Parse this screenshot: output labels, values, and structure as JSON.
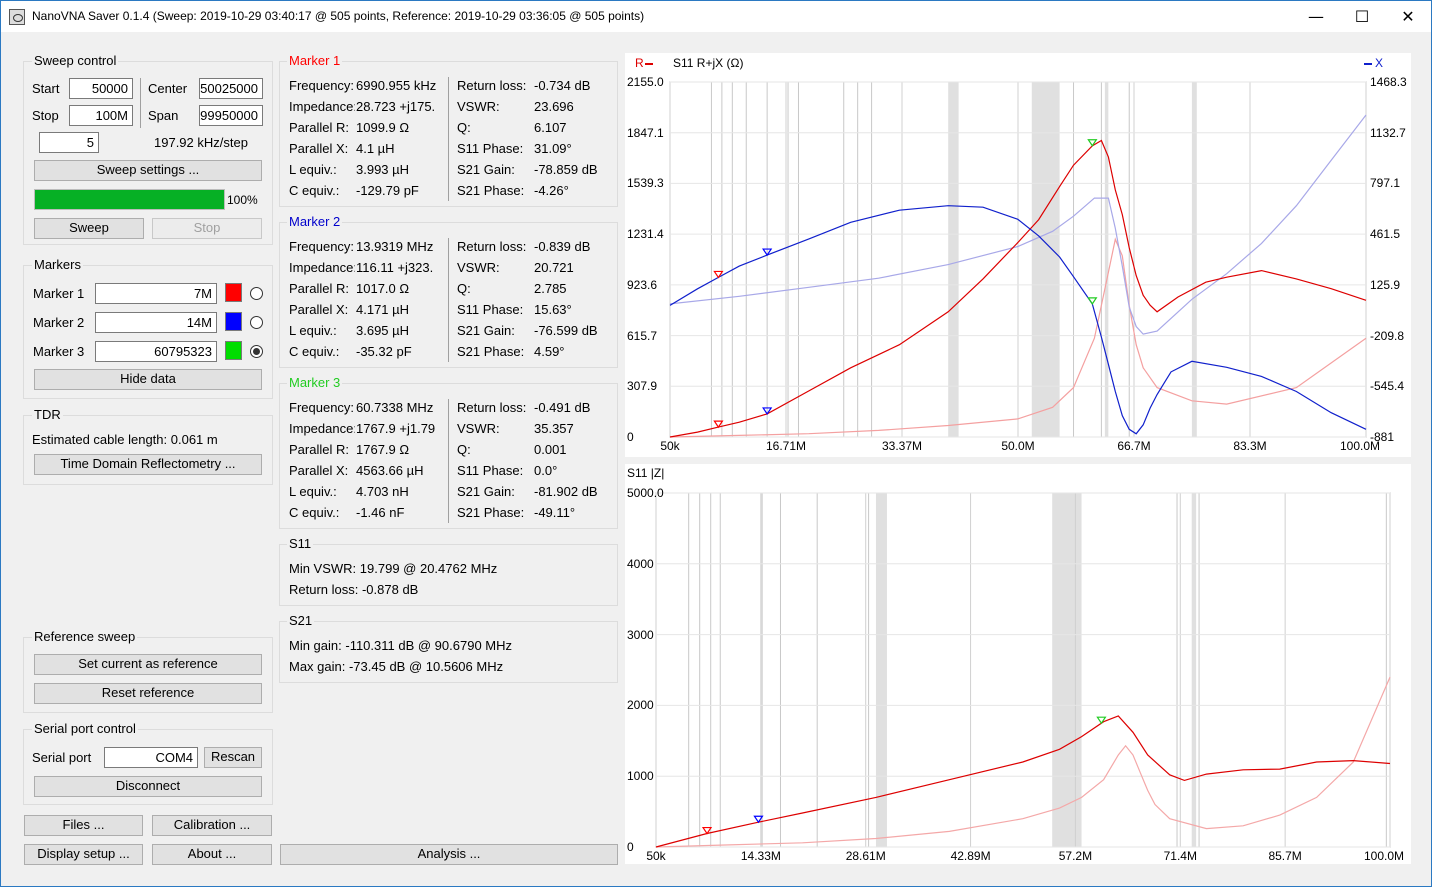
{
  "window": {
    "title": "NanoVNA Saver 0.1.4 (Sweep: 2019-10-29 03:40:17 @ 505 points, Reference: 2019-10-29 03:36:05 @ 505 points)",
    "minimize": "—",
    "maximize": "☐",
    "close": "✕"
  },
  "sweep_control": {
    "title": "Sweep control",
    "start_label": "Start",
    "start_value": "50000",
    "stop_label": "Stop",
    "stop_value": "100M",
    "center_label": "Center",
    "center_value": "50025000",
    "span_label": "Span",
    "span_value": "99950000",
    "points_value": "5",
    "step_text": "197.92 kHz/step",
    "settings_button": "Sweep settings ...",
    "progress_percent": 100,
    "progress_text": "100%",
    "sweep_button": "Sweep",
    "stop_button": "Stop"
  },
  "markers": {
    "title": "Markers",
    "items": [
      {
        "label": "Marker 1",
        "value": "7M",
        "color": "#ff0000",
        "selected": false
      },
      {
        "label": "Marker 2",
        "value": "14M",
        "color": "#0000ff",
        "selected": false
      },
      {
        "label": "Marker 3",
        "value": "60795323",
        "color": "#00dd00",
        "selected": true
      }
    ],
    "hide_button": "Hide data"
  },
  "tdr": {
    "title": "TDR",
    "cable_text": "Estimated cable length: 0.061 m",
    "button": "Time Domain Reflectometry ..."
  },
  "reference_sweep": {
    "title": "Reference sweep",
    "set_button": "Set current as reference",
    "reset_button": "Reset reference"
  },
  "serial": {
    "title": "Serial port control",
    "port_label": "Serial port",
    "port_value": "COM4",
    "rescan_button": "Rescan",
    "disconnect_button": "Disconnect"
  },
  "bottom_buttons": {
    "files": "Files ...",
    "calibration": "Calibration ...",
    "display_setup": "Display setup ...",
    "about": "About ...",
    "analysis": "Analysis ..."
  },
  "marker_panels": [
    {
      "title": "Marker 1",
      "color": "#ff0000",
      "left": [
        {
          "k": "Frequency:",
          "v": "6990.955 kHz"
        },
        {
          "k": "Impedance:",
          "v": "28.723 +j175."
        },
        {
          "k": "Parallel R:",
          "v": "1099.9 Ω"
        },
        {
          "k": "Parallel X:",
          "v": "4.1  µH"
        },
        {
          "k": "L equiv.:",
          "v": "3.993  µH"
        },
        {
          "k": "C equiv.:",
          "v": "-129.79  pF"
        }
      ],
      "right": [
        {
          "k": "Return loss:",
          "v": "-0.734 dB"
        },
        {
          "k": "VSWR:",
          "v": "23.696"
        },
        {
          "k": "Q:",
          "v": "6.107"
        },
        {
          "k": "S11  Phase:",
          "v": "31.09°"
        },
        {
          "k": "S21  Gain:",
          "v": "-78.859 dB"
        },
        {
          "k": "S21  Phase:",
          "v": "-4.26°"
        }
      ]
    },
    {
      "title": "Marker 2",
      "color": "#0000cc",
      "left": [
        {
          "k": "Frequency:",
          "v": "13.9319 MHz"
        },
        {
          "k": "Impedance:",
          "v": "116.11 +j323."
        },
        {
          "k": "Parallel R:",
          "v": "1017.0 Ω"
        },
        {
          "k": "Parallel X:",
          "v": "4.171  µH"
        },
        {
          "k": "L equiv.:",
          "v": "3.695  µH"
        },
        {
          "k": "C equiv.:",
          "v": "-35.32  pF"
        }
      ],
      "right": [
        {
          "k": "Return loss:",
          "v": "-0.839 dB"
        },
        {
          "k": "VSWR:",
          "v": "20.721"
        },
        {
          "k": "Q:",
          "v": "2.785"
        },
        {
          "k": "S11  Phase:",
          "v": "15.63°"
        },
        {
          "k": "S21  Gain:",
          "v": "-76.599 dB"
        },
        {
          "k": "S21  Phase:",
          "v": "4.59°"
        }
      ]
    },
    {
      "title": "Marker 3",
      "color": "#22cc22",
      "left": [
        {
          "k": "Frequency:",
          "v": "60.7338 MHz"
        },
        {
          "k": "Impedance:",
          "v": "1767.9 +j1.79"
        },
        {
          "k": "Parallel R:",
          "v": "1767.9 Ω"
        },
        {
          "k": "Parallel X:",
          "v": "4563.66  µH"
        },
        {
          "k": "L equiv.:",
          "v": "4.703  nH"
        },
        {
          "k": "C equiv.:",
          "v": "-1.46  nF"
        }
      ],
      "right": [
        {
          "k": "Return loss:",
          "v": "-0.491 dB"
        },
        {
          "k": "VSWR:",
          "v": "35.357"
        },
        {
          "k": "Q:",
          "v": "0.001"
        },
        {
          "k": "S11  Phase:",
          "v": "0.0°"
        },
        {
          "k": "S21  Gain:",
          "v": "-81.902 dB"
        },
        {
          "k": "S21  Phase:",
          "v": "-49.11°"
        }
      ]
    }
  ],
  "s11_summary": {
    "title": "S11",
    "min_vswr": "Min VSWR:   19.799 @ 20.4762 MHz",
    "return_loss": "Return loss: -0.878 dB"
  },
  "s21_summary": {
    "title": "S21",
    "min_gain": "Min gain:  -110.311 dB @ 90.6790 MHz",
    "max_gain": "Max gain:  -73.45 dB @ 10.5606 MHz"
  },
  "chart_data": [
    {
      "type": "line",
      "title": "S11  R+jX (Ω)",
      "legend_left": "R",
      "legend_right": "X",
      "x_ticks": [
        "50k",
        "16.71M",
        "33.37M",
        "50.0M",
        "66.7M",
        "83.3M",
        "100.0M"
      ],
      "y_left_ticks": [
        "2155.0",
        "1847.1",
        "1539.3",
        "1231.4",
        "923.6",
        "615.7",
        "307.9",
        "0"
      ],
      "y_right_ticks": [
        "1468.3",
        "1132.7",
        "797.1",
        "461.5",
        "125.9",
        "-209.8",
        "-545.4",
        "-881"
      ],
      "xlim": [
        0.05,
        100.0
      ],
      "ylim_left": [
        0,
        2155.0
      ],
      "ylim_right": [
        -881,
        1468.3
      ],
      "series": [
        {
          "name": "R",
          "axis": "left",
          "color": "#dd0000",
          "x": [
            0.05,
            4,
            7,
            10,
            14,
            20,
            26,
            33,
            40,
            45,
            50,
            53,
            56,
            58,
            60.7,
            62,
            63,
            64,
            65,
            66,
            67,
            68,
            69,
            70,
            73,
            77,
            80,
            85,
            90,
            95,
            100
          ],
          "y": [
            0,
            30,
            60,
            90,
            140,
            280,
            420,
            560,
            760,
            960,
            1180,
            1320,
            1520,
            1650,
            1767.9,
            1800,
            1700,
            1500,
            1350,
            1150,
            980,
            860,
            800,
            760,
            850,
            940,
            970,
            1010,
            960,
            900,
            830
          ]
        },
        {
          "name": "X",
          "axis": "right",
          "color": "#1020cc",
          "x": [
            0.05,
            4,
            7,
            10,
            14,
            20,
            26,
            33,
            40,
            45,
            50,
            53,
            56,
            58,
            60.7,
            62,
            63,
            64,
            65,
            66,
            67,
            68,
            69,
            70,
            72,
            75,
            80,
            85,
            90,
            95,
            100
          ],
          "y": [
            -10,
            100,
            175,
            250,
            323,
            430,
            540,
            620,
            650,
            640,
            560,
            450,
            310,
            180,
            0,
            -220,
            -400,
            -580,
            -740,
            -830,
            -860,
            -800,
            -690,
            -600,
            -450,
            -380,
            -420,
            -480,
            -580,
            -720,
            -830
          ]
        },
        {
          "name": "R ref",
          "axis": "left",
          "color": "#f4a0a0",
          "x": [
            0.05,
            10,
            20,
            30,
            40,
            50,
            55,
            58,
            61,
            63,
            64,
            65,
            66,
            67,
            68,
            70,
            75,
            80,
            90,
            100
          ],
          "y": [
            0,
            10,
            20,
            40,
            70,
            110,
            180,
            300,
            600,
            1000,
            1200,
            1100,
            800,
            560,
            420,
            300,
            220,
            200,
            300,
            600
          ]
        },
        {
          "name": "X ref",
          "axis": "right",
          "color": "#a8a8e8",
          "x": [
            0.05,
            10,
            20,
            30,
            40,
            50,
            55,
            58,
            61,
            63,
            64,
            65,
            66,
            67,
            68,
            70,
            75,
            80,
            85,
            90,
            95,
            100
          ],
          "y": [
            0,
            50,
            110,
            170,
            260,
            380,
            480,
            580,
            700,
            700,
            500,
            250,
            -20,
            -150,
            -200,
            -180,
            30,
            200,
            400,
            650,
            950,
            1250
          ]
        }
      ]
    },
    {
      "type": "line",
      "title": "S11  |Z|",
      "x_ticks": [
        "50k",
        "14.33M",
        "28.61M",
        "42.89M",
        "57.2M",
        "71.4M",
        "85.7M",
        "100.0M"
      ],
      "y_ticks": [
        "5000.0",
        "4000",
        "3000",
        "2000",
        "1000",
        "0"
      ],
      "xlim": [
        0.05,
        100.0
      ],
      "ylim": [
        0,
        5000
      ],
      "series": [
        {
          "name": "|Z|",
          "color": "#dd0000",
          "x": [
            0.05,
            7,
            14,
            20,
            30,
            40,
            50,
            55,
            58,
            61,
            63,
            65,
            67,
            70,
            72,
            75,
            80,
            85,
            90,
            95,
            100
          ],
          "y": [
            0,
            190,
            350,
            480,
            700,
            950,
            1200,
            1380,
            1560,
            1770,
            1850,
            1620,
            1300,
            1020,
            940,
            1030,
            1090,
            1100,
            1200,
            1220,
            1180
          ]
        },
        {
          "name": "|Z| ref",
          "color": "#f4a8a8",
          "x": [
            0.05,
            10,
            20,
            30,
            40,
            50,
            55,
            58,
            61,
            63,
            64,
            65,
            66,
            67,
            68,
            70,
            75,
            80,
            85,
            90,
            95,
            100
          ],
          "y": [
            0,
            30,
            60,
            120,
            220,
            400,
            550,
            700,
            950,
            1300,
            1430,
            1300,
            1050,
            800,
            600,
            400,
            260,
            300,
            450,
            700,
            1200,
            2400
          ]
        }
      ]
    }
  ]
}
